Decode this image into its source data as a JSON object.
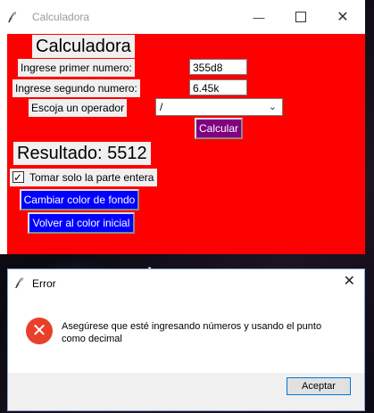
{
  "main_window": {
    "title": "Calculadora",
    "heading": "Calculadora",
    "label_first": "Ingrese primer numero:",
    "value_first": "355d8",
    "label_second": "Ingrese segundo numero:",
    "value_second": "6.45k",
    "label_operator": "Escoja un operador",
    "operator_selected": "/",
    "calc_button": "Calcular",
    "result": "Resultado: 5512",
    "checkbox_label": "Tomar solo la parte entera",
    "checkbox_checked": true,
    "btn_change_color": "Cambiar color de fondo",
    "btn_reset_color": "Volver al color inicial"
  },
  "error_dialog": {
    "title": "Error",
    "message": "Asegúrese que esté ingresando números y usando el punto como decimal",
    "ok_button": "Aceptar"
  },
  "colors": {
    "background": "#ff0000",
    "calc_button": "#800080",
    "color_buttons": "#0000ff",
    "error_icon": "#e8402a"
  },
  "icons": {
    "app": "feather-icon",
    "minimize": "minimize-icon",
    "maximize": "maximize-icon",
    "close": "close-icon",
    "dropdown": "chevron-down-icon",
    "error": "error-icon"
  }
}
